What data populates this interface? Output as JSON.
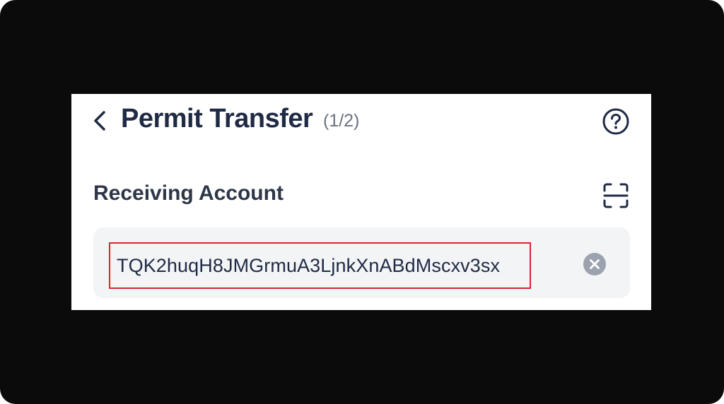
{
  "header": {
    "back_icon": "chevron-left-icon",
    "title": "Permit Transfer",
    "step": "(1/2)",
    "help_icon": "question-circle-icon"
  },
  "receiving_account": {
    "label": "Receiving Account",
    "scan_icon": "scan-frame-icon",
    "address_value": "TQK2huqH8JMGrmuA3LjnkXnABdMscxv3sx",
    "clear_icon": "clear-circle-icon"
  },
  "colors": {
    "text_primary": "#1f2a44",
    "text_secondary": "#6b7280",
    "input_background": "#f3f4f6",
    "highlight_border": "#d62631",
    "clear_icon_bg": "#9ca3af",
    "frame_background": "#0b0b0b"
  }
}
